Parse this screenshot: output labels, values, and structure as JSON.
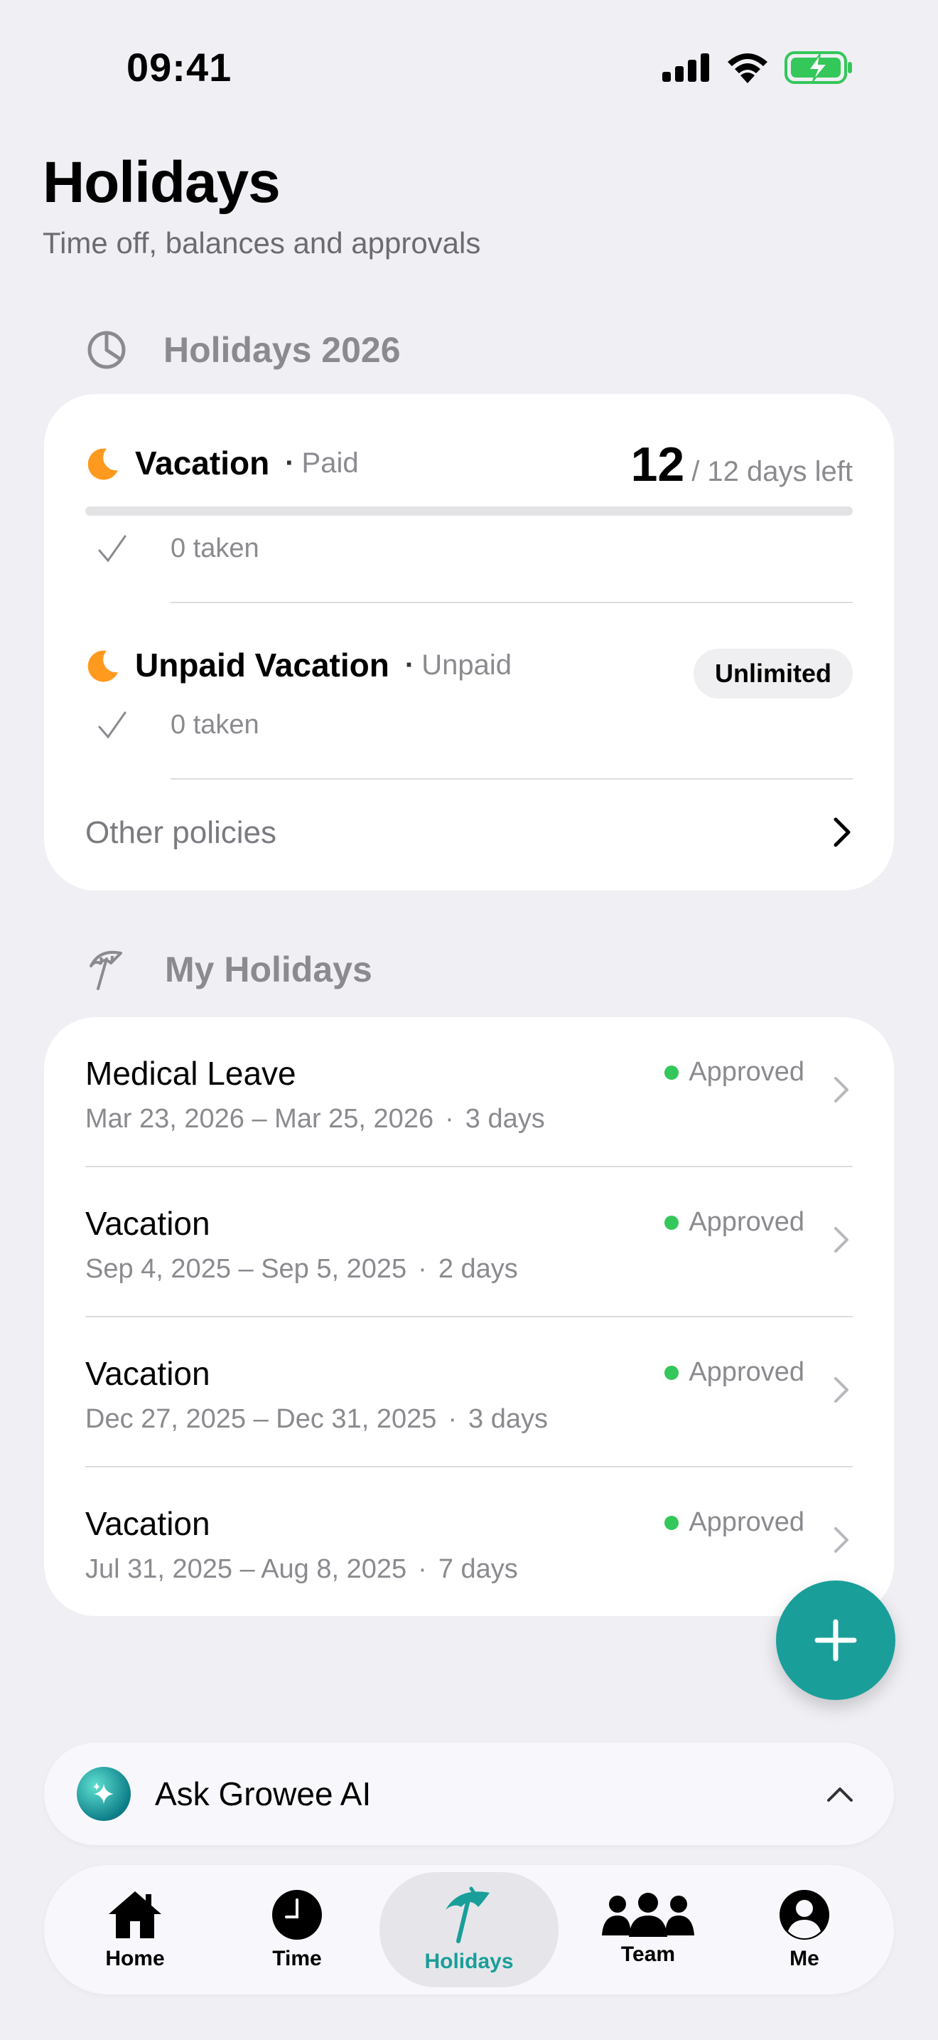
{
  "status_bar": {
    "time": "09:41"
  },
  "header": {
    "title": "Holidays",
    "subtitle": "Time off, balances and approvals"
  },
  "policies_section": {
    "title": "Holidays 2026",
    "policies": [
      {
        "name": "Vacation",
        "kind": "Paid",
        "days_left": "12",
        "days_total_text": "/ 12 days left",
        "taken": "0 taken",
        "used_fraction": 0
      },
      {
        "name": "Unpaid Vacation",
        "kind": "Unpaid",
        "badge": "Unlimited",
        "taken": "0 taken"
      }
    ],
    "other_policies": "Other policies"
  },
  "my_holidays_section": {
    "title": "My Holidays",
    "items": [
      {
        "title": "Medical Leave",
        "dates": "Mar 23, 2026 – Mar 25, 2026",
        "duration": "3 days",
        "status": "Approved"
      },
      {
        "title": "Vacation",
        "dates": "Sep 4, 2025 – Sep 5, 2025",
        "duration": "2 days",
        "status": "Approved"
      },
      {
        "title": "Vacation",
        "dates": "Dec 27, 2025 – Dec 31, 2025",
        "duration": "3 days",
        "status": "Approved"
      },
      {
        "title": "Vacation",
        "dates": "Jul 31, 2025 – Aug 8, 2025",
        "duration": "7 days",
        "status": "Approved"
      }
    ]
  },
  "ai_bar": {
    "label": "Ask Growee AI"
  },
  "tabbar": {
    "tabs": [
      {
        "label": "Home",
        "icon": "home-icon"
      },
      {
        "label": "Time",
        "icon": "clock-icon"
      },
      {
        "label": "Holidays",
        "icon": "beach-umbrella-icon",
        "active": true
      },
      {
        "label": "Team",
        "icon": "team-icon"
      },
      {
        "label": "Me",
        "icon": "person-icon"
      }
    ]
  },
  "colors": {
    "accent": "#1a9e9a",
    "approved": "#34c759",
    "moon": "#ff9a1f",
    "background": "#efeff4"
  }
}
